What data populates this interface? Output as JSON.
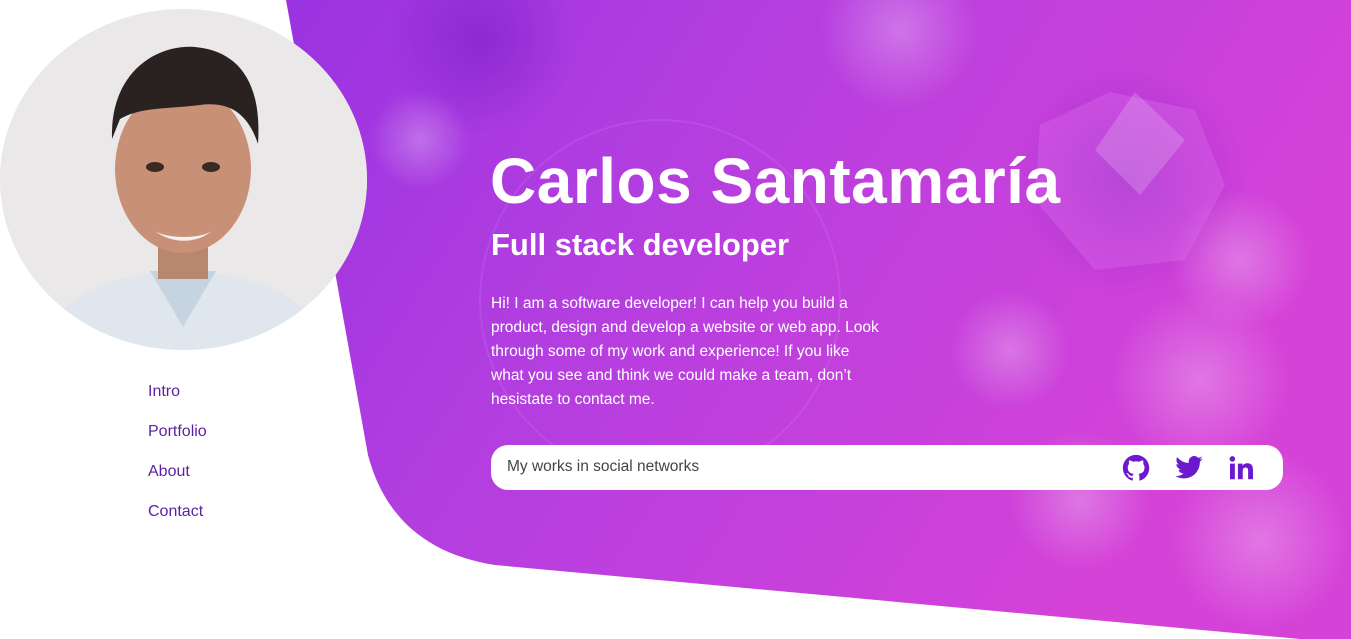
{
  "colors": {
    "gradient_start": "#8a2be2",
    "gradient_end": "#d542d8",
    "nav_text": "#5b1fa3",
    "icon": "#6b18cf"
  },
  "nav": {
    "items": [
      {
        "label": "Intro"
      },
      {
        "label": "Portfolio"
      },
      {
        "label": "About"
      },
      {
        "label": "Contact"
      }
    ]
  },
  "hero": {
    "name": "Carlos Santamaría",
    "role": "Full stack developer",
    "description": "Hi! I am a software developer! I can help you build a product, design and develop a website or web app. Look through some of my work and experience! If you like what you see and think we could make a team, don’t hesistate to contact me."
  },
  "social": {
    "label": "My works in social networks",
    "icons": [
      "github-icon",
      "twitter-icon",
      "linkedin-icon"
    ]
  }
}
